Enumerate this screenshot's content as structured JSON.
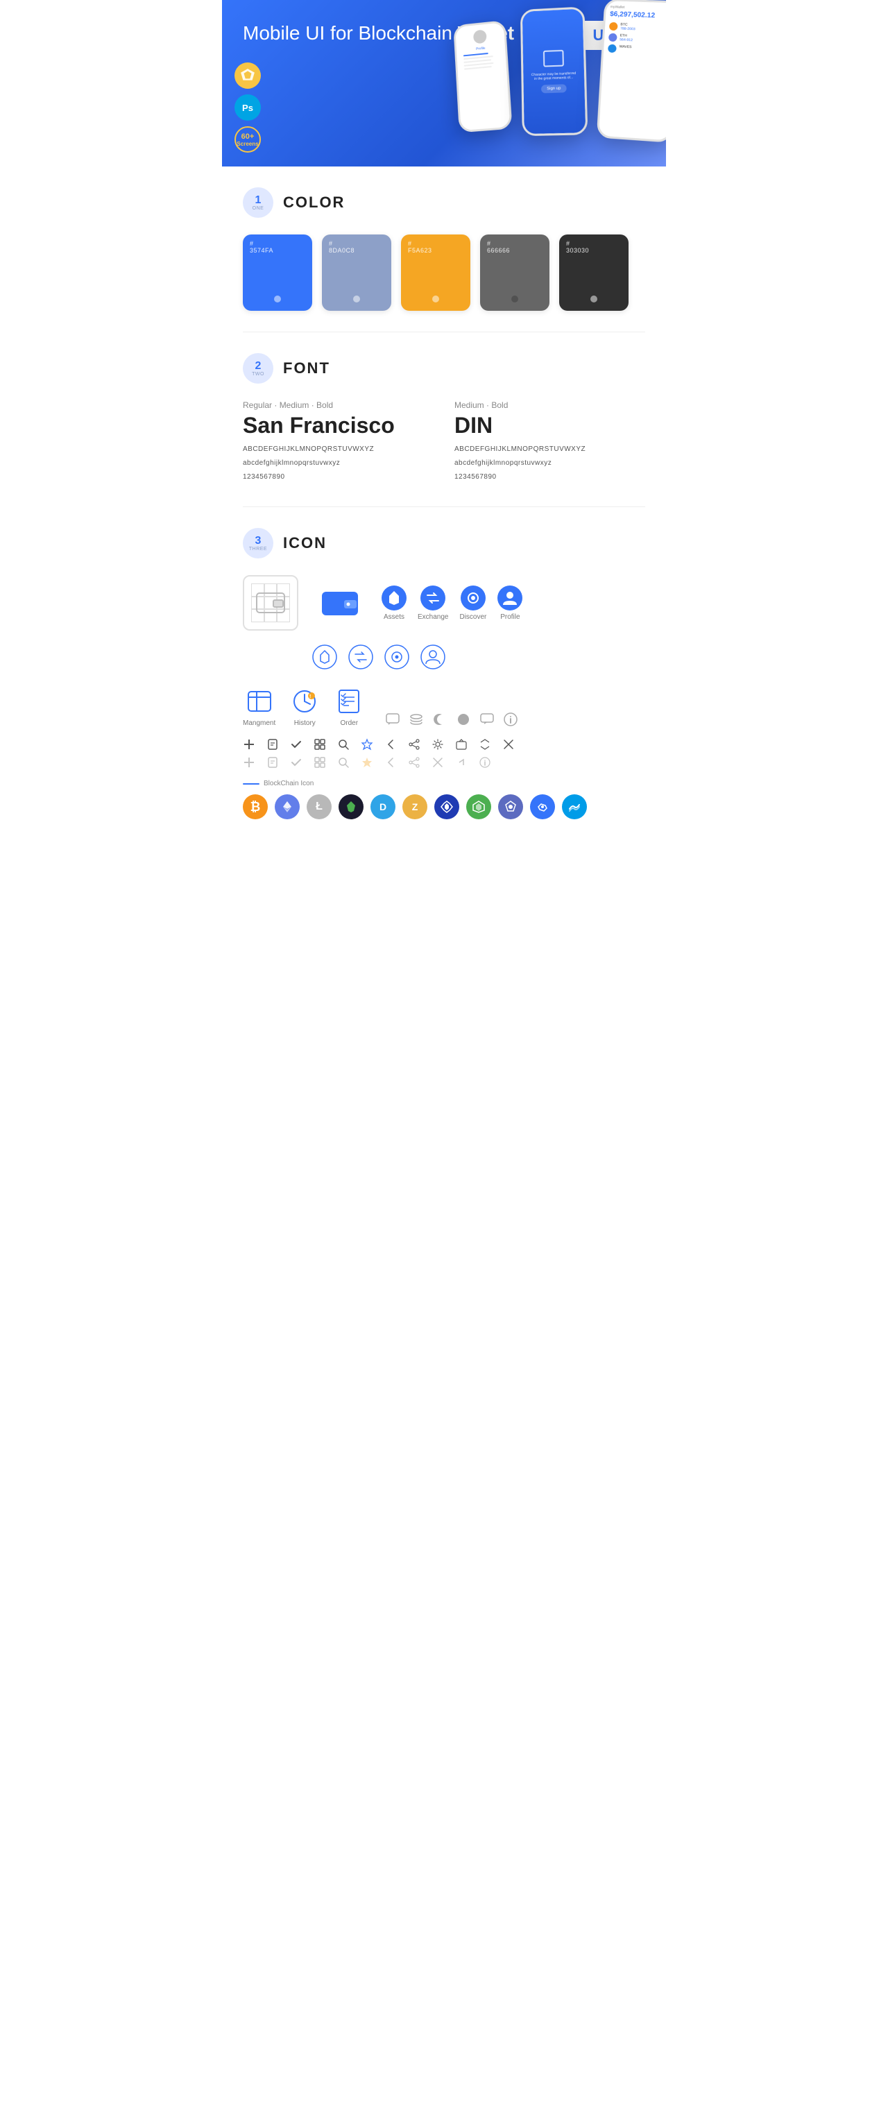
{
  "hero": {
    "title": "Mobile UI for Blockchain ",
    "title_bold": "Wallet",
    "badge": "UI Kit",
    "badges": [
      {
        "label": "S",
        "bg": "#F7C544",
        "type": "sketch"
      },
      {
        "label": "Ps",
        "bg": "#00A4E4",
        "type": "ps"
      },
      {
        "label": "60+",
        "sub": "Screens",
        "type": "screens"
      }
    ]
  },
  "sections": {
    "color": {
      "number": "1",
      "word": "ONE",
      "title": "COLOR",
      "swatches": [
        {
          "code": "#3574FA",
          "bg": "#3574FA",
          "light": false
        },
        {
          "code": "#8DA0C8",
          "bg": "#8DA0C8",
          "light": false
        },
        {
          "code": "#F5A623",
          "bg": "#F5A623",
          "light": false
        },
        {
          "code": "#666666",
          "bg": "#666666",
          "light": false
        },
        {
          "code": "#303030",
          "bg": "#303030",
          "light": false
        }
      ]
    },
    "font": {
      "number": "2",
      "word": "TWO",
      "title": "FONT",
      "fonts": [
        {
          "label": "Regular · Medium · Bold",
          "name": "San Francisco",
          "uppercase": "ABCDEFGHIJKLMNOPQRSTUVWXYZ",
          "lowercase": "abcdefghijklmnopqrstuvwxyz",
          "numbers": "1234567890"
        },
        {
          "label": "Medium · Bold",
          "name": "DIN",
          "uppercase": "ABCDEFGHIJKLMNOPQRSTUVWXYZ",
          "lowercase": "abcdefghijklmnopqrstuvwxyz",
          "numbers": "1234567890"
        }
      ]
    },
    "icon": {
      "number": "3",
      "word": "THREE",
      "title": "ICON",
      "named_icons": [
        {
          "label": "Assets",
          "type": "diamond"
        },
        {
          "label": "Exchange",
          "type": "exchange"
        },
        {
          "label": "Discover",
          "type": "discover"
        },
        {
          "label": "Profile",
          "type": "profile"
        }
      ],
      "action_icons": [
        {
          "label": "Mangment",
          "type": "management"
        },
        {
          "label": "History",
          "type": "history"
        },
        {
          "label": "Order",
          "type": "order"
        }
      ],
      "small_icons": [
        "+",
        "📋",
        "✓",
        "⊞",
        "🔍",
        "☆",
        "<",
        "🔗",
        "⚙",
        "⊡",
        "⇄",
        "✕"
      ],
      "blockchain_label": "BlockChain Icon",
      "cryptos": [
        {
          "symbol": "₿",
          "bg": "#F7931A",
          "color": "#fff",
          "name": "Bitcoin"
        },
        {
          "symbol": "⬡",
          "bg": "#627EEA",
          "color": "#fff",
          "name": "Ethereum"
        },
        {
          "symbol": "Ł",
          "bg": "#B8B8B8",
          "color": "#fff",
          "name": "Litecoin"
        },
        {
          "symbol": "◆",
          "bg": "#1E1E1E",
          "color": "#fff",
          "name": "BlackCoin"
        },
        {
          "symbol": "D",
          "bg": "#2FA4E7",
          "color": "#fff",
          "name": "Dash"
        },
        {
          "symbol": "Z",
          "bg": "#ECB244",
          "color": "#fff",
          "name": "Zcash"
        },
        {
          "symbol": "◈",
          "bg": "#3D5AFE",
          "color": "#fff",
          "name": "Icon"
        },
        {
          "symbol": "▲",
          "bg": "#4CAF50",
          "color": "#fff",
          "name": "Augur"
        },
        {
          "symbol": "◇",
          "bg": "#5C6BC0",
          "color": "#fff",
          "name": "Ark"
        },
        {
          "symbol": "∞",
          "bg": "#3574FA",
          "color": "#fff",
          "name": "Matic"
        },
        {
          "symbol": "~",
          "bg": "#00B8D9",
          "color": "#fff",
          "name": "Waves"
        }
      ]
    }
  }
}
